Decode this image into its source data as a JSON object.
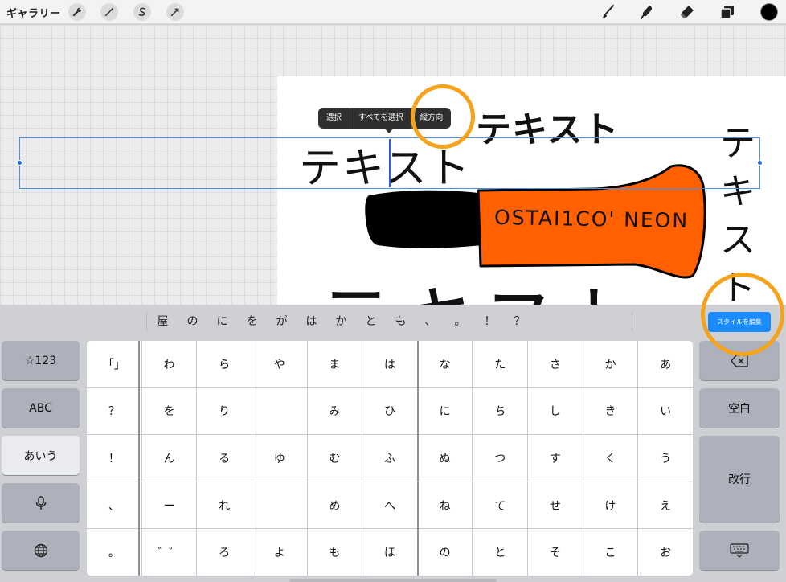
{
  "toolbar": {
    "gallery_label": "ギャラリー",
    "actions": [
      "wrench-icon",
      "magic-wand-icon",
      "selection-s-icon",
      "transform-arrow-icon"
    ],
    "tools": [
      "brush-icon",
      "smudge-icon",
      "eraser-icon",
      "layers-icon"
    ],
    "current_color": "#000000"
  },
  "canvas": {
    "text_bold": "テキスト",
    "text_main": "テキスト",
    "text_vertical": "テキスト",
    "text_bottom_partial": "テキスト",
    "marker_label": "OSTAI1CO' NEON",
    "marker_colors": {
      "cap": "#000000",
      "body": "#ff6000"
    }
  },
  "context_menu": {
    "items": [
      "選択",
      "すべてを選択",
      "縦方向"
    ]
  },
  "candidate_bar": {
    "candidates": [
      "屋",
      "の",
      "に",
      "を",
      "が",
      "は",
      "か",
      "と",
      "も",
      "、",
      "。",
      "！",
      "？"
    ],
    "edit_style_label": "スタイルを編集"
  },
  "keyboard": {
    "left_keys": [
      "☆123",
      "ABC",
      "あいう",
      "mic-icon",
      "globe-icon"
    ],
    "active_left_key": "あいう",
    "right_keys": {
      "delete": "delete-icon",
      "space": "空白",
      "enter": "改行",
      "dismiss": "keyboard-dismiss-icon"
    },
    "rows": [
      [
        "「」",
        "わ",
        "ら",
        "や",
        "ま",
        "は",
        "な",
        "た",
        "さ",
        "か",
        "あ"
      ],
      [
        "？",
        "を",
        "り",
        "",
        "み",
        "ひ",
        "に",
        "ち",
        "し",
        "き",
        "い"
      ],
      [
        "！",
        "ん",
        "る",
        "ゆ",
        "む",
        "ふ",
        "ぬ",
        "つ",
        "す",
        "く",
        "う"
      ],
      [
        "、",
        "ー",
        "れ",
        "",
        "め",
        "へ",
        "ね",
        "て",
        "せ",
        "け",
        "え"
      ],
      [
        "。",
        "゛゜",
        "ろ",
        "よ",
        "も",
        "ほ",
        "の",
        "と",
        "そ",
        "こ",
        "お"
      ]
    ]
  },
  "annotation_color": "#f5a21c"
}
